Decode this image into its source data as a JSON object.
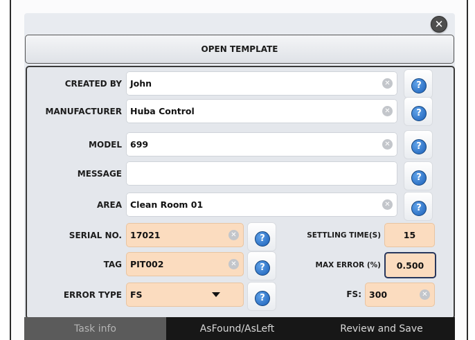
{
  "dialog": {
    "close_symbol": "✕",
    "open_template_label": "OPEN TEMPLATE"
  },
  "form": {
    "created_by": {
      "label": "CREATED BY",
      "value": "John"
    },
    "manufacturer": {
      "label": "MANUFACTURER",
      "value": "Huba Control"
    },
    "model": {
      "label": "MODEL",
      "value": "699"
    },
    "message": {
      "label": "MESSAGE",
      "value": ""
    },
    "area": {
      "label": "AREA",
      "value": "Clean Room 01"
    },
    "serial_no": {
      "label": "SERIAL NO.",
      "value": "17021"
    },
    "tag": {
      "label": "TAG",
      "value": "PIT002"
    },
    "error_type": {
      "label": "ERROR TYPE",
      "value": "FS"
    },
    "settling_time": {
      "label": "SETTLING TIME(S)",
      "value": "15"
    },
    "max_error": {
      "label": "MAX ERROR (%)",
      "value": "0.500"
    },
    "fs": {
      "label": "FS:",
      "value": "300"
    }
  },
  "icons": {
    "help": "?",
    "clear": "✕"
  },
  "tabs": [
    {
      "label": "Task info"
    },
    {
      "label": "AsFound/AsLeft"
    },
    {
      "label": "Review and Save"
    }
  ],
  "colors": {
    "orange_field": "#fbdcbf",
    "help_blue": "#1b5fb8",
    "tab_active": "#5b5b5b",
    "tab_bar": "#171717"
  }
}
